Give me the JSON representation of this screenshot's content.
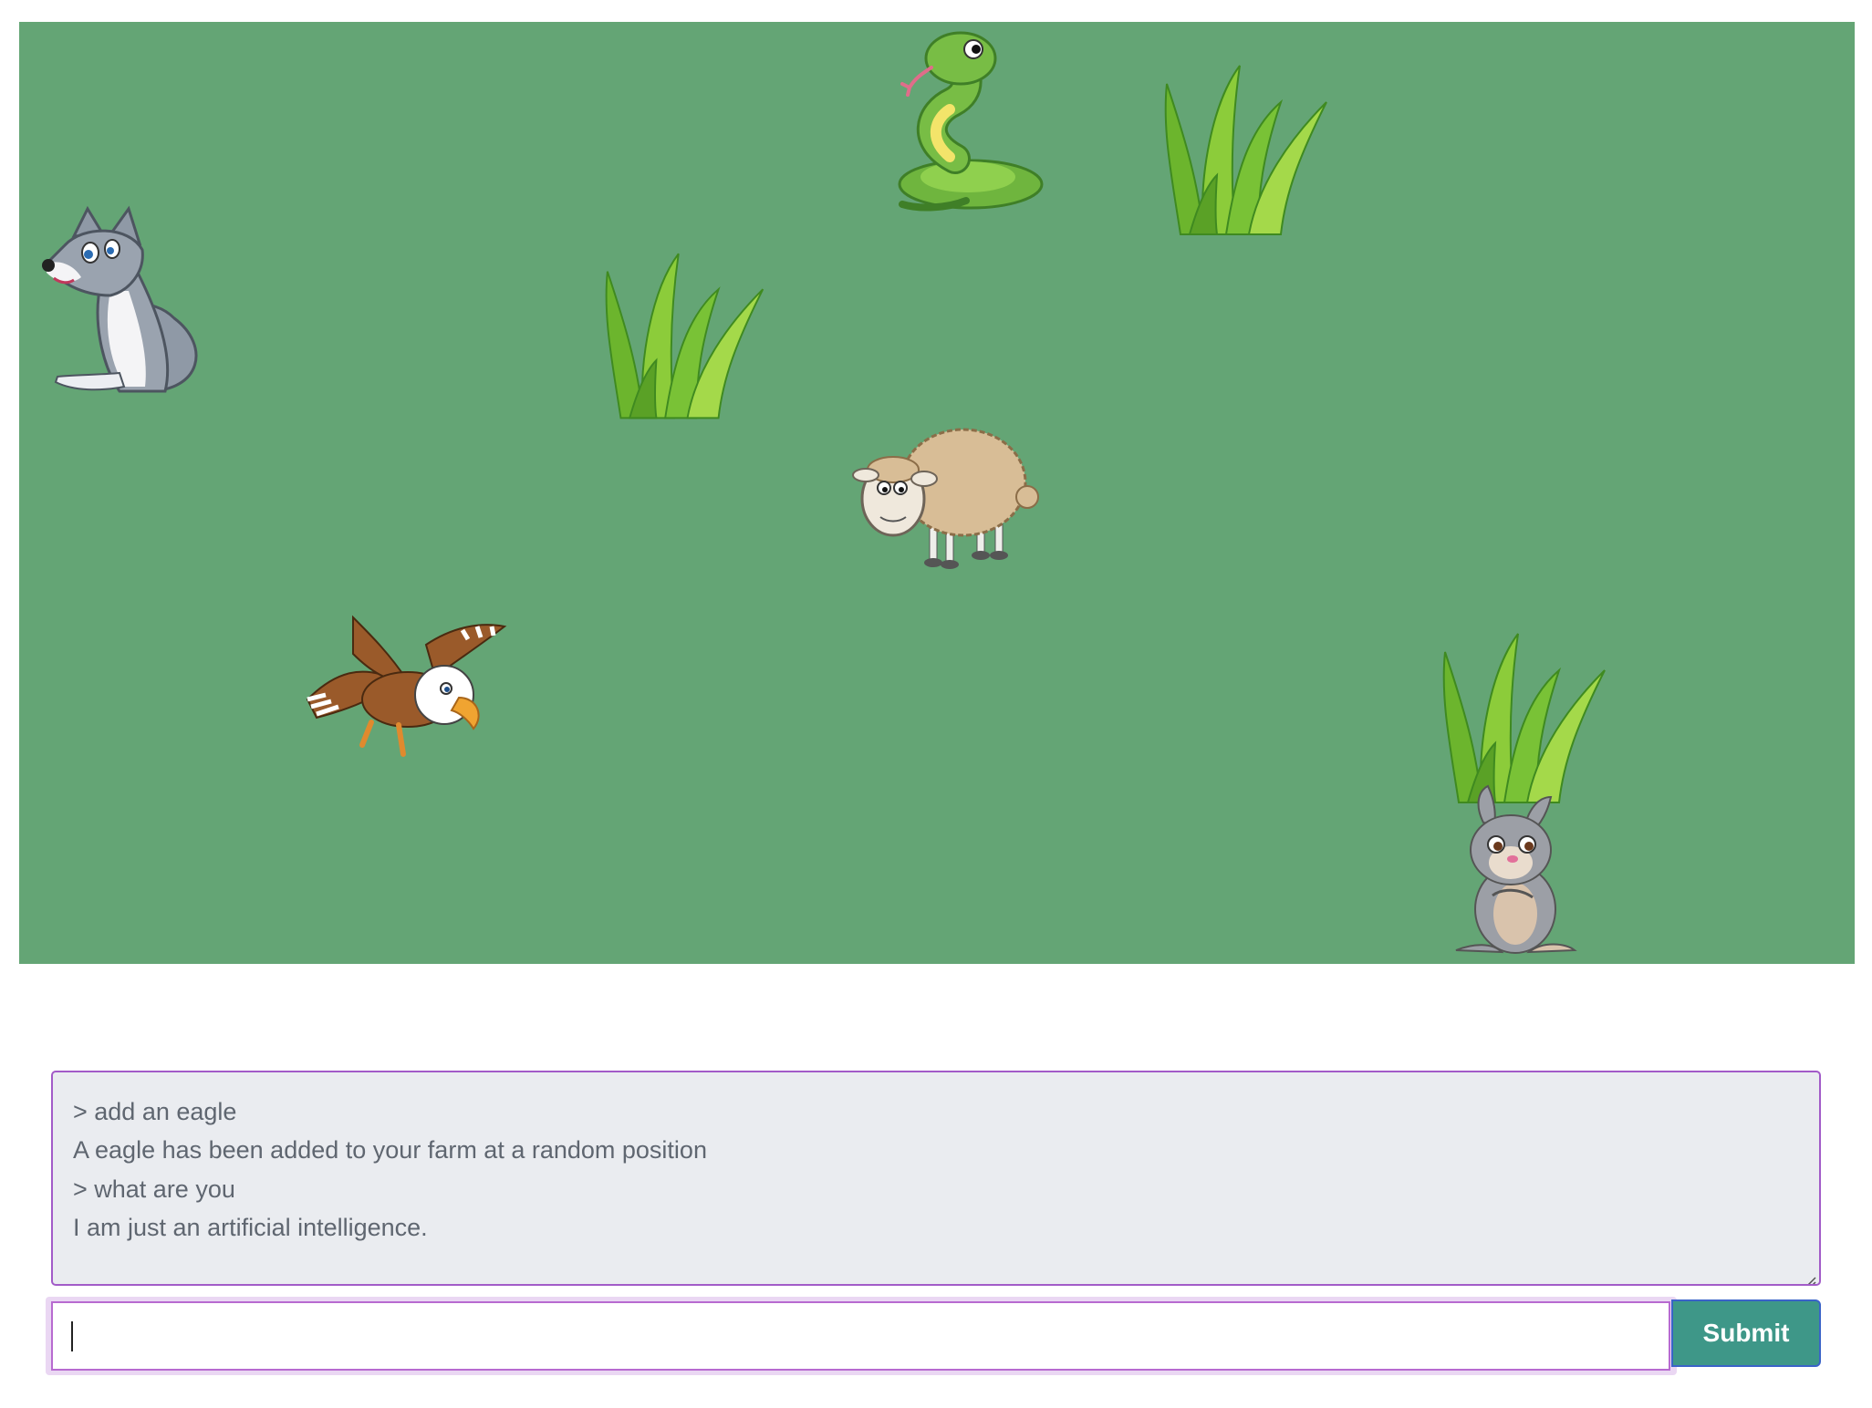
{
  "farm": {
    "background": "#64a575",
    "entities": [
      "snake-icon",
      "grass-icon",
      "wolf-icon",
      "grass-icon",
      "sheep-icon",
      "eagle-icon",
      "grass-icon",
      "rabbit-icon"
    ]
  },
  "console": {
    "lines": [
      "> add an eagle",
      "A eagle has been added to your farm at a random position",
      "> what are you",
      "I am just an artificial intelligence."
    ]
  },
  "command": {
    "value": "",
    "placeholder": ""
  },
  "submit": {
    "label": "Submit"
  },
  "colors": {
    "accent": "#3e9788",
    "focus_border": "#b76ad0",
    "log_background": "#eaecf0",
    "log_text": "#5f6670"
  }
}
